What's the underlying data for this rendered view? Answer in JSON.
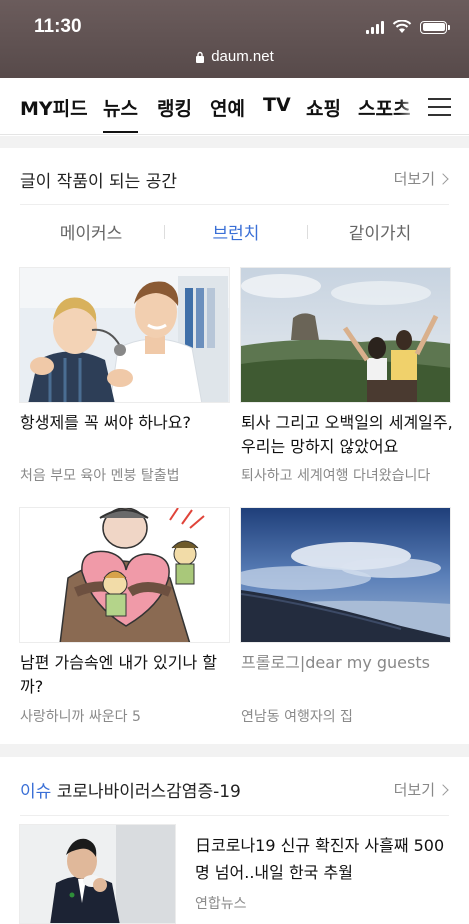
{
  "status": {
    "time": "11:30",
    "url": "daum.net"
  },
  "nav": {
    "items": [
      "MY피드",
      "뉴스",
      "랭킹",
      "연예",
      "TV",
      "쇼핑",
      "스포츠"
    ],
    "active": "뉴스"
  },
  "section1": {
    "title": "글이 작품이 되는 공간",
    "more": "더보기",
    "tabs": [
      "메이커스",
      "브런치",
      "같이가치"
    ],
    "active_tab": "브런치",
    "cards": [
      {
        "title": "항생제를 꼭 써야 하나요?",
        "source": "처음 부모 육아 멘붕 탈출법"
      },
      {
        "title": "퇴사 그리고 오백일의 세계일주, 우리는 망하지 않았어요",
        "source": "퇴사하고 세계여행 다녀왔습니다"
      },
      {
        "title": "남편 가슴속엔 내가 있기나 할까?",
        "source": "사랑하니까 싸운다 5"
      },
      {
        "title": "프롤로그|dear my guests",
        "source": "연남동 여행자의 집"
      }
    ]
  },
  "section2": {
    "label": "이슈",
    "title": "코로나바이러스감염증-19",
    "more": "더보기",
    "news": {
      "title": "日코로나19 신규 확진자 사흘째 500명 넘어..내일 한국 추월",
      "source": "연합뉴스"
    }
  },
  "colors": {
    "accent": "#3a6fd6",
    "status_bg": "#574a4a"
  }
}
